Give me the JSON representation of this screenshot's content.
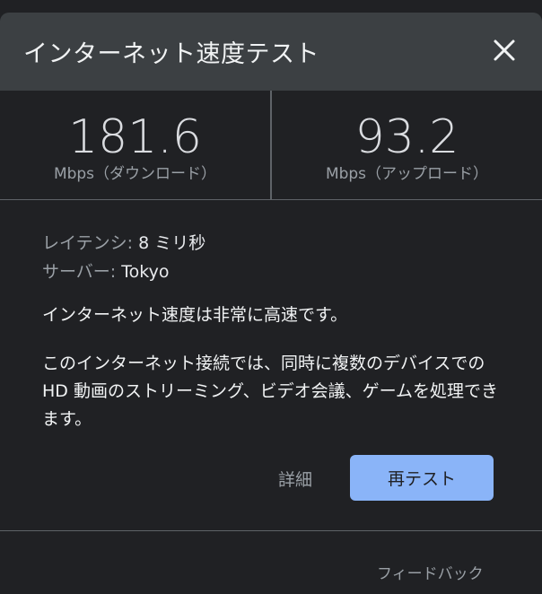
{
  "dialog": {
    "title": "インターネット速度テスト",
    "close_icon": "close-icon"
  },
  "download": {
    "value": "181.6",
    "unit": "Mbps（ダウンロード）"
  },
  "upload": {
    "value": "93.2",
    "unit": "Mbps（アップロード）"
  },
  "latency": {
    "label": "レイテンシ:",
    "value": "8 ミリ秒"
  },
  "server": {
    "label": "サーバー:",
    "value": "Tokyo"
  },
  "summary": "インターネット速度は非常に高速です。",
  "description": "このインターネット接続では、同時に複数のデバイスでの HD 動画のストリーミング、ビデオ会議、ゲームを処理できます。",
  "actions": {
    "details": "詳細",
    "retest": "再テスト"
  },
  "feedback": "フィードバック",
  "colors": {
    "accent": "#8ab4f8",
    "header_bg": "#3c4043",
    "body_bg": "#202124"
  }
}
